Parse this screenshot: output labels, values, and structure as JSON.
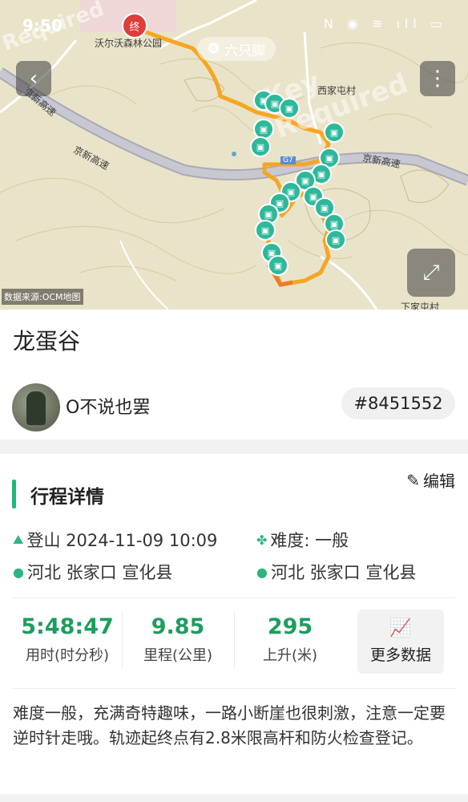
{
  "status_bar": {
    "time": "9:50",
    "icons": "N ◉ ≋ ıll ▭"
  },
  "watermark": {
    "line1": "Required",
    "line2": "Key Required"
  },
  "map": {
    "brand_label": "六只脚",
    "source_label": "数据来源:OCM地图",
    "labels": {
      "park": "沃尔沃森林公园",
      "highway_left": "京新高速",
      "highway_mid": "京新高速",
      "highway_right": "京新高速",
      "village": "西家屯村",
      "village_bottom": "下家屯村",
      "road_code": "G7"
    },
    "end_marker": "终",
    "route_color": "#f5a623",
    "pin_color": "#2db89a"
  },
  "trip": {
    "title": "龙蛋谷",
    "user_name": "O不说也罢",
    "trip_id": "#8451552"
  },
  "details": {
    "edit_label": "编辑",
    "section_title": "行程详情",
    "activity": "登山 2024-11-09 10:09",
    "difficulty": "难度:  一般",
    "start_location": "河北 张家口 宣化县",
    "end_location": "河北 张家口 宣化县",
    "accent_color": "#1db97c"
  },
  "stats": {
    "duration_value": "5:48:47",
    "duration_label": "用时(时分秒)",
    "distance_value": "9.85",
    "distance_label": "里程(公里)",
    "ascent_value": "295",
    "ascent_label": "上升(米)",
    "more_label": "更多数据"
  },
  "description": "难度一般，充满奇特趣味，一路小断崖也很刺激，注意一定要逆时针走哦。轨迹起终点有2.8米限高杆和防火检查登记。"
}
